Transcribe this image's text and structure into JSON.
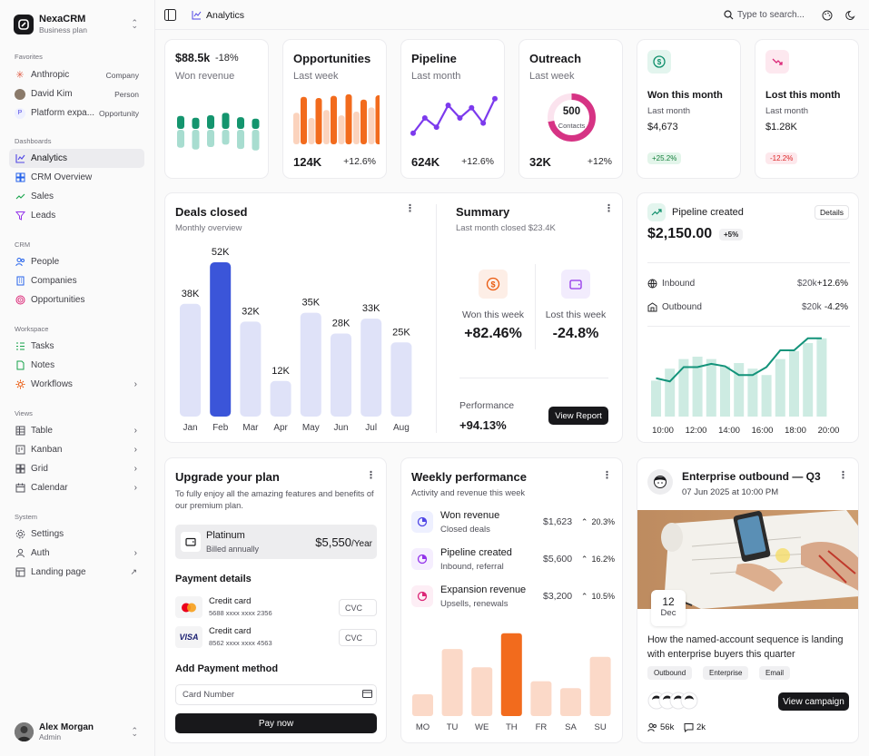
{
  "brand": {
    "name": "NexaCRM",
    "plan": "Business plan"
  },
  "sidebar": {
    "favorites_label": "Favorites",
    "favorites": [
      {
        "label": "Anthropic",
        "meta": "Company"
      },
      {
        "label": "David Kim",
        "meta": "Person"
      },
      {
        "label": "Platform expa...",
        "meta": "Opportunity"
      }
    ],
    "dashboards_label": "Dashboards",
    "dashboards": [
      {
        "label": "Analytics"
      },
      {
        "label": "CRM Overview"
      },
      {
        "label": "Sales"
      },
      {
        "label": "Leads"
      }
    ],
    "crm_label": "CRM",
    "crm": [
      {
        "label": "People"
      },
      {
        "label": "Companies"
      },
      {
        "label": "Opportunities"
      }
    ],
    "workspace_label": "Workspace",
    "workspace": [
      {
        "label": "Tasks"
      },
      {
        "label": "Notes"
      },
      {
        "label": "Workflows"
      }
    ],
    "views_label": "Views",
    "views": [
      {
        "label": "Table"
      },
      {
        "label": "Kanban"
      },
      {
        "label": "Grid"
      },
      {
        "label": "Calendar"
      }
    ],
    "system_label": "System",
    "system": [
      {
        "label": "Settings"
      },
      {
        "label": "Auth"
      },
      {
        "label": "Landing page"
      }
    ]
  },
  "user": {
    "name": "Alex Morgan",
    "role": "Admin"
  },
  "topbar": {
    "breadcrumb": "Analytics",
    "search_placeholder": "Type to search..."
  },
  "kpis": {
    "revenue": {
      "value": "$88.5k",
      "delta": "-18%",
      "subtitle": "Won revenue",
      "bars": [
        {
          "top": 0.42,
          "bottom": 0.58
        },
        {
          "top": 0.36,
          "bottom": 0.64
        },
        {
          "top": 0.44,
          "bottom": 0.56
        },
        {
          "top": 0.52,
          "bottom": 0.48
        },
        {
          "top": 0.38,
          "bottom": 0.62
        },
        {
          "top": 0.33,
          "bottom": 0.67
        }
      ]
    },
    "opportunities": {
      "title": "Opportunities",
      "subtitle": "Last week",
      "value": "124K",
      "delta": "+12.6%",
      "bars": [
        {
          "a": 0.6,
          "b": 0.9
        },
        {
          "a": 0.5,
          "b": 0.88
        },
        {
          "a": 0.65,
          "b": 0.92
        },
        {
          "a": 0.55,
          "b": 0.95
        },
        {
          "a": 0.62,
          "b": 0.85
        },
        {
          "a": 0.7,
          "b": 0.93
        }
      ]
    },
    "pipeline": {
      "title": "Pipeline",
      "subtitle": "Last month",
      "value": "624K",
      "delta": "+12.6%",
      "line": [
        20,
        50,
        32,
        75,
        50,
        70,
        40,
        88
      ]
    },
    "outreach": {
      "title": "Outreach",
      "subtitle": "Last week",
      "value": "32K",
      "delta": "+12%",
      "ring_value": "500",
      "ring_label": "Contacts",
      "ring_percent": 72
    },
    "won_month": {
      "title": "Won this month",
      "subtitle": "Last month",
      "value": "$4,673",
      "badge": "+25.2%"
    },
    "lost_month": {
      "title": "Lost this month",
      "subtitle": "Last month",
      "value": "$1.28K",
      "badge": "-12.2%"
    }
  },
  "deals": {
    "title": "Deals closed",
    "subtitle": "Monthly overview",
    "chart_data": {
      "type": "bar",
      "categories": [
        "Jan",
        "Feb",
        "Mar",
        "Apr",
        "May",
        "Jun",
        "Jul",
        "Aug"
      ],
      "values": [
        38,
        52,
        32,
        12,
        35,
        28,
        33,
        25
      ],
      "labels": [
        "38K",
        "52K",
        "32K",
        "12K",
        "35K",
        "28K",
        "33K",
        "25K"
      ],
      "highlight": "Feb"
    }
  },
  "summary": {
    "title": "Summary",
    "subtitle": "Last month closed $23.4K",
    "won_label": "Won this week",
    "won_value": "+82.46%",
    "lost_label": "Lost this week",
    "lost_value": "-24.8%",
    "perf_label": "Performance",
    "perf_value": "+94.13%",
    "button": "View Report"
  },
  "pipeline_created": {
    "title": "Pipeline created",
    "details": "Details",
    "value": "$2,150.00",
    "badge": "+5%",
    "rows": [
      {
        "label": "Inbound",
        "amount": "$20k",
        "delta": "+12.6%"
      },
      {
        "label": "Outbound",
        "amount": "$20k",
        "delta": "-4.2%"
      }
    ],
    "chart_data": {
      "type": "bar",
      "x_labels": [
        "10:00",
        "12:00",
        "14:00",
        "16:00",
        "18:00",
        "20:00"
      ],
      "bars": [
        0.45,
        0.6,
        0.72,
        0.75,
        0.72,
        0.63,
        0.67,
        0.6,
        0.52,
        0.72,
        0.82,
        0.92,
        0.98
      ],
      "line": [
        0.48,
        0.44,
        0.62,
        0.62,
        0.66,
        0.63,
        0.52,
        0.52,
        0.62,
        0.83,
        0.83,
        0.98,
        0.98
      ]
    }
  },
  "upgrade": {
    "title": "Upgrade your plan",
    "desc": "To fully enjoy all the amazing features and benefits of our premium plan.",
    "plan_name": "Platinum",
    "plan_billing": "Billed annually",
    "plan_price": "$5,550",
    "plan_period": "/Year",
    "payment_label": "Payment details",
    "cards": [
      {
        "brand": "mc",
        "label": "Credit card",
        "number": "5688 xxxx xxxx 2356",
        "cvc": "CVC"
      },
      {
        "brand": "VISA",
        "label": "Credit card",
        "number": "8562 xxxx xxxx 4563",
        "cvc": "CVC"
      }
    ],
    "add_label": "Add Payment method",
    "card_placeholder": "Card Number",
    "pay_button": "Pay now"
  },
  "weekly": {
    "title": "Weekly performance",
    "subtitle": "Activity and revenue this week",
    "rows": [
      {
        "title": "Won revenue",
        "sub": "Closed deals",
        "amount": "$1,623",
        "pct": "20.3%",
        "color": "#4f46e5",
        "bg": "#eef0ff"
      },
      {
        "title": "Pipeline created",
        "sub": "Inbound, referral",
        "amount": "$5,600",
        "pct": "16.2%",
        "color": "#9333ea",
        "bg": "#f5eefe"
      },
      {
        "title": "Expansion revenue",
        "sub": "Upsells, renewals",
        "amount": "$3,200",
        "pct": "10.5%",
        "color": "#db2777",
        "bg": "#fdeef5"
      }
    ],
    "chart_data": {
      "type": "bar",
      "categories": [
        "MO",
        "TU",
        "WE",
        "TH",
        "FR",
        "SA",
        "SU"
      ],
      "values": [
        25,
        77,
        56,
        95,
        40,
        32,
        68
      ],
      "highlight": "TH"
    }
  },
  "enterprise": {
    "title": "Enterprise outbound — Q3",
    "date": "07 Jun 2025 at 10:00 PM",
    "day": "12",
    "month": "Dec",
    "text": "How the named-account sequence is landing with enterprise buyers this quarter",
    "tags": [
      "Outbound",
      "Enterprise",
      "Email"
    ],
    "button": "View campaign",
    "members": "56k",
    "comments": "2k"
  }
}
